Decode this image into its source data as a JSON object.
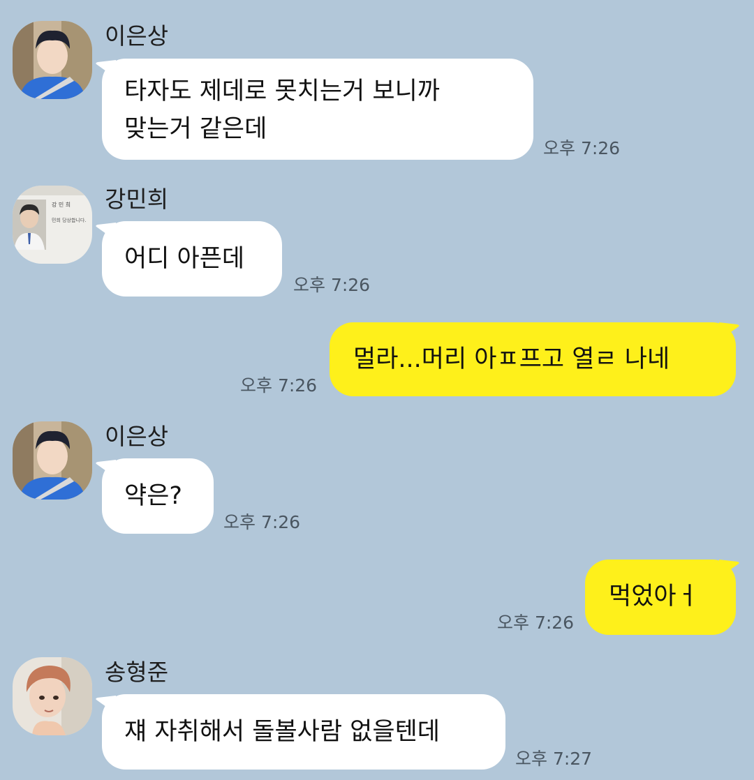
{
  "chat": {
    "messages": [
      {
        "sender": "이은상",
        "line1": "타자도 제데로 못치는거 보니까",
        "line2": "맞는거 같은데",
        "time": "오후 7:26"
      },
      {
        "sender": "강민희",
        "text": "어디 아픈데",
        "time": "오후 7:26",
        "avatar_text": [
          "강 민 희",
          "민희 당상합니다."
        ]
      },
      {
        "text": "멀라...머리 아ㅍ프고 열ㄹ 나네",
        "time": "오후 7:26"
      },
      {
        "sender": "이은상",
        "text": "약은?",
        "time": "오후 7:26"
      },
      {
        "text": "먹었아ㅓ",
        "time": "오후 7:26"
      },
      {
        "sender": "송형준",
        "text": "쟤 자취해서 돌볼사람 없을텐데",
        "time": "오후 7:27"
      }
    ]
  },
  "colors": {
    "background": "#b2c7d9",
    "incoming_bubble": "#ffffff",
    "outgoing_bubble": "#fef01b",
    "time_text": "#4a5661"
  }
}
